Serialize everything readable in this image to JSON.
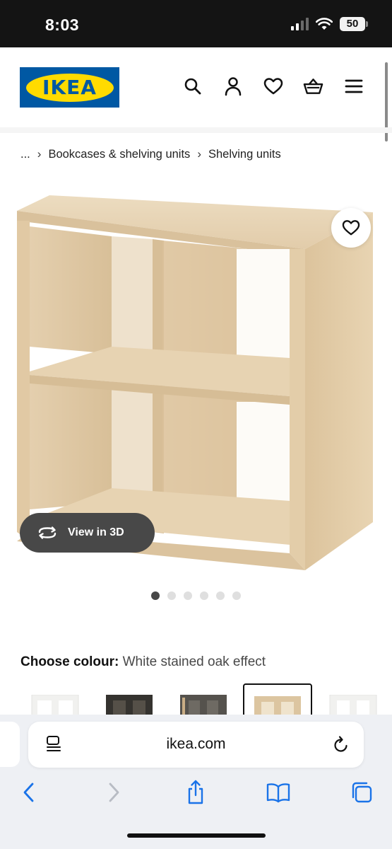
{
  "status_bar": {
    "time": "8:03",
    "battery_level": "50",
    "icons": [
      "cellular-signal-icon",
      "wifi-icon",
      "battery-icon"
    ]
  },
  "header": {
    "logo_text": "IKEA",
    "icons": [
      "search-icon",
      "account-icon",
      "favourites-icon",
      "shopping-bag-icon",
      "menu-icon"
    ]
  },
  "breadcrumb": {
    "items": [
      "...",
      "Bookcases & shelving units",
      "Shelving units"
    ]
  },
  "product": {
    "image_icon": "shelving-unit-image",
    "view_3d_label": "View in 3D",
    "gallery": {
      "total_images": 6,
      "active_index": 0
    }
  },
  "colour": {
    "label": "Choose colour:",
    "value": "White stained oak effect",
    "swatches": [
      {
        "name": "white",
        "color": "#f4f4f2",
        "selected": false
      },
      {
        "name": "black-brown",
        "color": "#3a3835",
        "selected": false
      },
      {
        "name": "grey-oak",
        "color": "#5a5a58",
        "selected": false
      },
      {
        "name": "white-stained-oak",
        "color": "#dcc5a0",
        "selected": true
      },
      {
        "name": "white-2",
        "color": "#f2f2f0",
        "selected": false
      }
    ]
  },
  "browser": {
    "url": "ikea.com",
    "toolbar_icons": [
      "back-icon",
      "forward-icon",
      "share-icon",
      "bookmarks-icon",
      "tabs-icon"
    ]
  },
  "colors": {
    "ikea_blue": "#0058a3",
    "ikea_yellow": "#ffdb00",
    "wood": "#e6d2b0",
    "ios_blue": "#1a73e8"
  }
}
